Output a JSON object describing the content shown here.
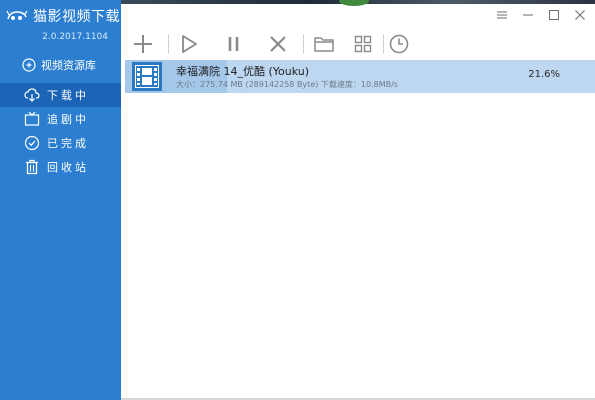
{
  "app": {
    "title": "猫影视频下载",
    "version": "2.0.2017.1104",
    "resource_label": "视频资源库"
  },
  "sidebar": {
    "items": [
      {
        "label": "下载中",
        "icon": "cloud-download-icon",
        "active": true
      },
      {
        "label": "追剧中",
        "icon": "tv-icon",
        "active": false
      },
      {
        "label": "已完成",
        "icon": "check-circle-icon",
        "active": false
      },
      {
        "label": "回收站",
        "icon": "trash-icon",
        "active": false
      }
    ]
  },
  "toolbar": {
    "buttons": [
      "add-icon",
      "play-icon",
      "pause-icon",
      "delete-icon",
      "folder-icon",
      "grid-icon",
      "clock-icon"
    ]
  },
  "window_controls": [
    "menu-icon",
    "minimize-icon",
    "maximize-icon",
    "close-icon"
  ],
  "downloads": [
    {
      "title": "幸福满院 14_优酷 (Youku)",
      "detail": "大小：275.74 MB (289142258 Byte) 下载速度：10.8MB/s",
      "percent_label": "21.6%",
      "progress": 0.216
    }
  ],
  "colors": {
    "sidebar_bg": "#2c7fd0",
    "sidebar_active": "#1b64b6",
    "row_selected": "#bdd7f0",
    "icon_gray": "#8a8a8a"
  }
}
